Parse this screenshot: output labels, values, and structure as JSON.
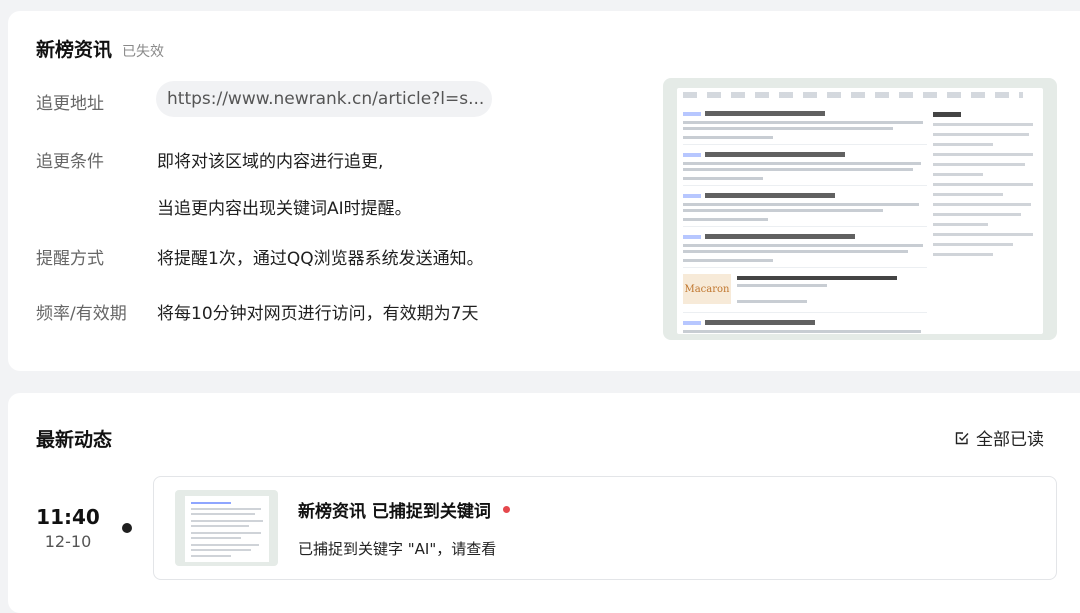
{
  "monitor": {
    "title": "新榜资讯",
    "status": "已失效",
    "url_label": "追更地址",
    "url_value": "https://www.newrank.cn/article?l=s...",
    "condition_label": "追更条件",
    "condition_line1": "即将对该区域的内容进行追更,",
    "condition_line2": "当追更内容出现关键词AI时提醒。",
    "notify_label": "提醒方式",
    "notify_value": "将提醒1次，通过QQ浏览器系统发送通知。",
    "frequency_label": "频率/有效期",
    "frequency_value": "将每10分钟对网页进行访问，有效期为7天",
    "preview_thumbnail_text": "Macaron"
  },
  "activity": {
    "title": "最新动态",
    "mark_all_read": "全部已读",
    "events": [
      {
        "time": "11:40",
        "date": "12-10",
        "title": "新榜资讯 已捕捉到关键词",
        "description": "已捕捉到关键字 \"AI\"，请查看",
        "unread": true
      }
    ]
  },
  "colors": {
    "background": "#f2f3f5",
    "card": "#ffffff",
    "unread_dot": "#e5484d",
    "preview_bg": "#e5ebe7"
  }
}
